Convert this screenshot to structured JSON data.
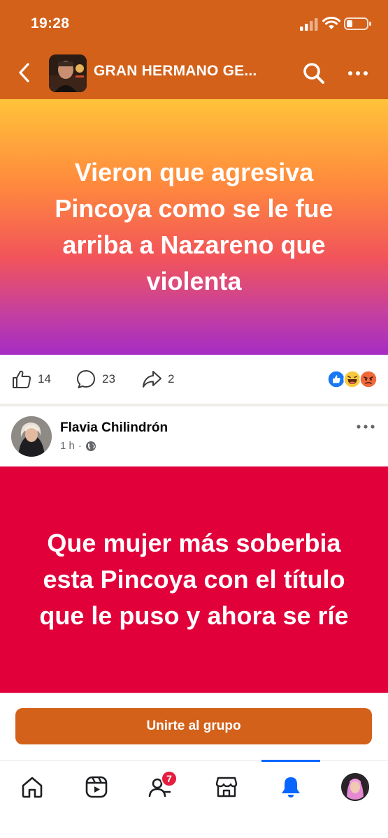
{
  "status_bar": {
    "time": "19:28"
  },
  "group": {
    "title": "GRAN HERMANO GE..."
  },
  "post1": {
    "text": "Vieron que agresiva Pincoya como se le fue arriba a Nazareno que violenta",
    "likes": "14",
    "comments": "23",
    "shares": "2",
    "banner_gradient": [
      "#FFC33A",
      "#FF8A3D",
      "#F2545A",
      "#C43FA0",
      "#A52CC4"
    ],
    "reaction_icons": [
      "like-icon",
      "haha-icon",
      "angry-icon"
    ]
  },
  "post2": {
    "author": "Flavia Chilindrón",
    "time": "1 h",
    "separator": "·",
    "privacy_icon": "globe-icon",
    "text": "Que mujer más soberbia esta Pincoya con el título que le puso y ahora se ríe",
    "banner_color": "#E1003A"
  },
  "join_button": {
    "label": "Unirte al grupo"
  },
  "tab_bar": {
    "tabs": [
      "home-icon",
      "reels-icon",
      "friends-icon",
      "marketplace-icon",
      "notifications-icon",
      "profile-avatar"
    ],
    "friends_badge": "7",
    "active_tab": "notifications-icon"
  },
  "colors": {
    "brand": "#D3611A",
    "active": "#0866FF",
    "badge": "#E41E3F"
  }
}
